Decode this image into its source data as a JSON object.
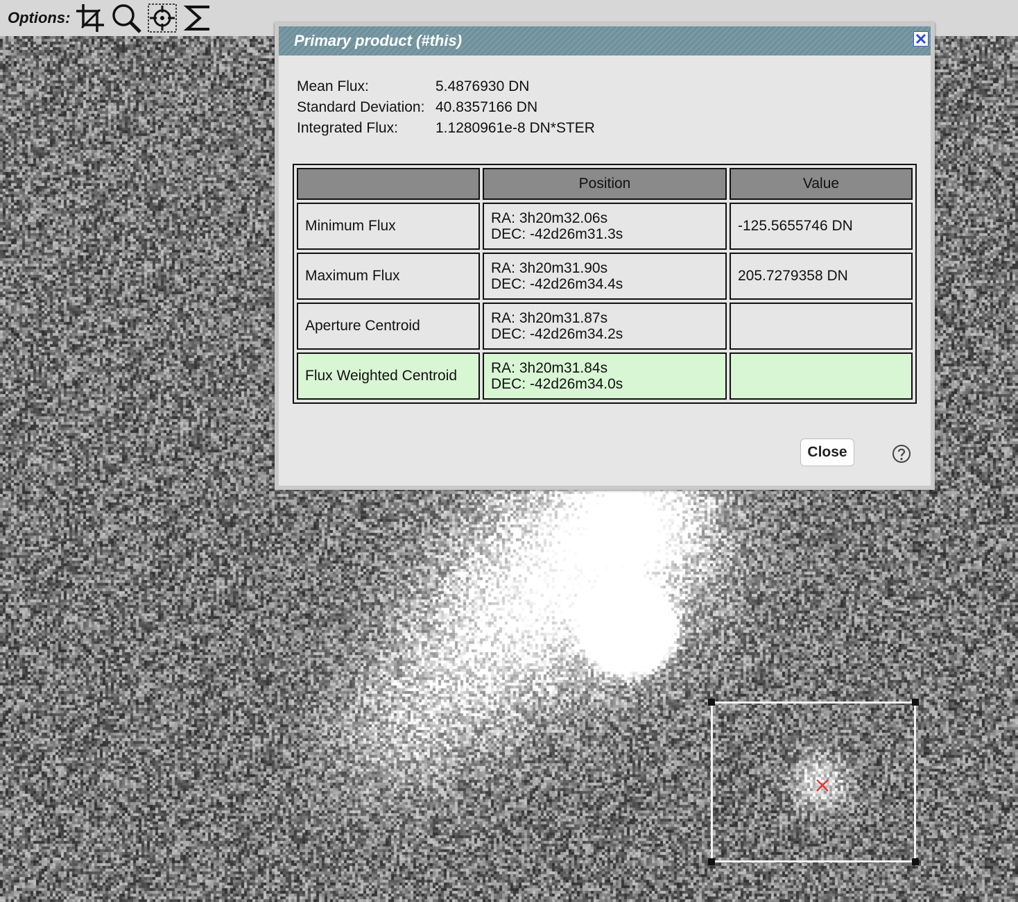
{
  "toolbar": {
    "label": "Options:",
    "tools": [
      "crop-icon",
      "magnifier-icon",
      "crosshair-icon",
      "sigma-icon"
    ]
  },
  "dialog": {
    "title": "Primary product (#this)",
    "stats": [
      {
        "label": "Mean Flux:",
        "value": "5.4876930 DN"
      },
      {
        "label": "Standard Deviation:",
        "value": "40.8357166 DN"
      },
      {
        "label": "Integrated Flux:",
        "value": "1.1280961e-8 DN*STER"
      }
    ],
    "table": {
      "headers": [
        "",
        "Position",
        "Value"
      ],
      "rows": [
        {
          "name": "Minimum Flux",
          "ra": "RA: 3h20m32.06s",
          "dec": "DEC: -42d26m31.3s",
          "value": "-125.5655746 DN"
        },
        {
          "name": "Maximum Flux",
          "ra": "RA: 3h20m31.90s",
          "dec": "DEC: -42d26m34.4s",
          "value": "205.7279358 DN"
        },
        {
          "name": "Aperture Centroid",
          "ra": "RA: 3h20m31.87s",
          "dec": "DEC: -42d26m34.2s",
          "value": ""
        },
        {
          "name": "Flux Weighted Centroid",
          "ra": "RA: 3h20m31.84s",
          "dec": "DEC: -42d26m34.0s",
          "value": ""
        }
      ]
    },
    "close_label": "Close",
    "help_icon": "help-icon",
    "close_icon": "close-x-icon"
  },
  "colors": {
    "titlebar": "#7a9ba5",
    "header_cell": "#8a8a8a",
    "highlight_row": "#d9f6d4",
    "centroid_marker": "#e53935"
  }
}
